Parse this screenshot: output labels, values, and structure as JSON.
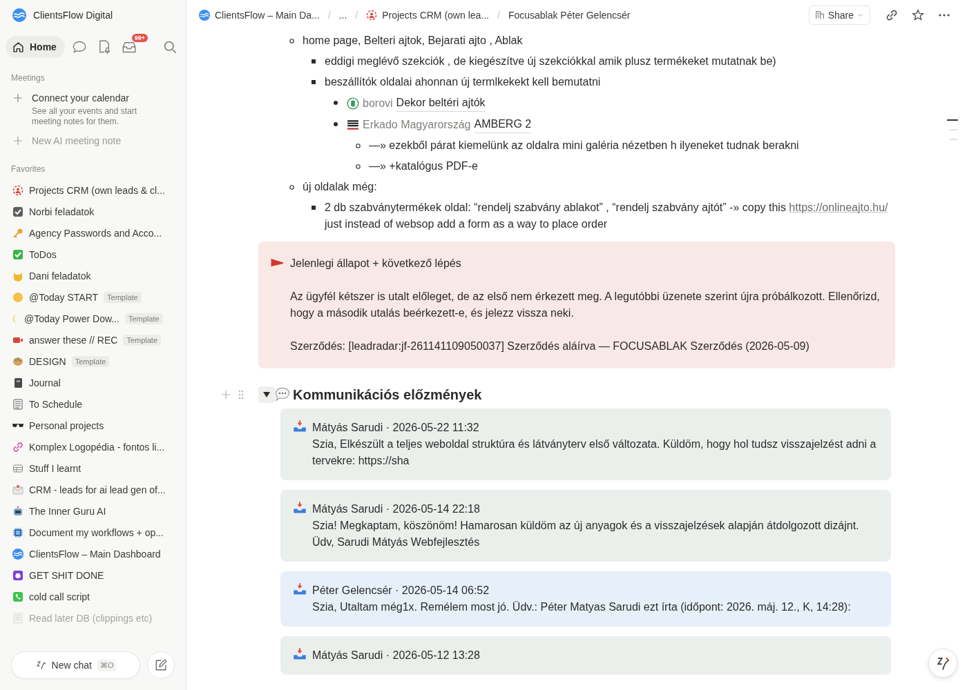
{
  "workspace": {
    "name": "ClientsFlow Digital"
  },
  "nav": {
    "home": "Home",
    "inbox_badge": "99+"
  },
  "meetings": {
    "heading": "Meetings",
    "connect_title": "Connect your calendar",
    "connect_text": "See all your events and start meeting notes for them.",
    "new_note": "New AI meeting note"
  },
  "favorites": {
    "heading": "Favorites",
    "items": [
      {
        "label": "Projects CRM (own leads & cl...",
        "faded": false
      },
      {
        "label": "Norbi feladatok",
        "faded": false
      },
      {
        "label": "Agency Passwords and Acco...",
        "faded": false
      },
      {
        "label": "ToDos",
        "faded": false
      },
      {
        "label": "Dani feladatok",
        "faded": false
      },
      {
        "label": "@Today START",
        "badge": "Template",
        "faded": false
      },
      {
        "label": "@Today Power Dow...",
        "badge": "Template",
        "faded": false
      },
      {
        "label": "answer these // REC",
        "badge": "Template",
        "faded": false
      },
      {
        "label": "DESIGN",
        "badge": "Template",
        "faded": false
      },
      {
        "label": "Journal",
        "faded": false
      },
      {
        "label": "To Schedule",
        "faded": false
      },
      {
        "label": "Personal projects",
        "faded": false
      },
      {
        "label": "Komplex Logopédia - fontos li...",
        "faded": false
      },
      {
        "label": "Stuff I learnt",
        "faded": false
      },
      {
        "label": "CRM - leads for ai lead gen of...",
        "faded": false
      },
      {
        "label": "The Inner Guru AI",
        "faded": false
      },
      {
        "label": "Document my workflows + op...",
        "faded": false
      },
      {
        "label": "ClientsFlow – Main Dashboard",
        "faded": false
      },
      {
        "label": "GET SHIT DONE",
        "faded": false
      },
      {
        "label": "cold call script",
        "faded": false
      },
      {
        "label": "Read later DB (clippings etc)",
        "faded": true
      }
    ]
  },
  "new_chat": {
    "label": "New chat",
    "shortcut": "⌘O"
  },
  "breadcrumbs": [
    "ClientsFlow – Main Da...",
    "...",
    "Projects CRM (own lea...",
    "Focusablak Péter Gelencsér"
  ],
  "breadcrumb_separator": "/",
  "share": "Share",
  "outline": [
    {
      "selected": true
    },
    {
      "selected": false
    },
    {
      "selected": false
    }
  ],
  "list": [
    {
      "kind": "text",
      "text": "home page, Belteri ajtok, Bejarati ajto , Ablak",
      "children": [
        {
          "kind": "text",
          "text": "eddigi meglévő szekciók , de kiegészítve új szekciókkal amik plusz termékeket mutatnak be)"
        },
        {
          "kind": "text",
          "text": "beszállítók oldalai ahonnan új termlkekekt kell bemutatni",
          "children": [
            {
              "kind": "mention",
              "prefix": "borovi",
              "title": "Dekor beltéri ajtók"
            },
            {
              "kind": "mention",
              "prefix": "Erkado Magyarország",
              "title": "AMBERG 2",
              "children": [
                {
                  "kind": "text",
                  "text": "—» ezekből párat kiemelünk az oldalra mini galéria nézetben h ilyeneket tudnak berakni"
                },
                {
                  "kind": "text",
                  "text": "—» +katalógus PDF-e"
                }
              ]
            }
          ]
        }
      ]
    },
    {
      "kind": "text",
      "text": "új oldalak még:",
      "children": [
        {
          "kind": "link_text",
          "text": "2  db szabványtermékek oldal: “rendelj szabvány ablakot” , “rendelj szabvány ajtót” -» copy this ",
          "link": "https://onlineajto.hu/",
          "after": " just instead of websop add a form as a way to place order"
        }
      ]
    }
  ],
  "callout": {
    "title": "Jelenlegi állapot + következő lépés",
    "paragraphs": [
      "Az ügyfél kétszer is utalt előleget, de az első nem érkezett meg. A legutóbbi üzenete szerint újra próbálkozott. Ellenőrizd, hogy a második utalás beérkezett-e, és jelezz vissza neki.",
      "Szerződés: [leadradar:jf-261141109050037] Szerződés aláírva — FOCUSABLAK Szerződés (2026-05-09)"
    ]
  },
  "section": {
    "title": "Kommunikációs előzmények",
    "expanded": true,
    "messages": [
      {
        "header": "Mátyás Sarudi · 2026-05-22 11:32",
        "body": "Szia, Elkészült a teljes weboldal struktúra és látványterv első változata. Küldöm, hogy hol tudsz visszajelzést adni a tervekre: https://sha",
        "color": "#ebefec"
      },
      {
        "header": "Mátyás Sarudi · 2026-05-14 22:18",
        "body": "Szia! Megkaptam, köszönöm! Hamarosan küldöm az új anyagok és a visszajelzések alapján átdolgozott dizájnt. Üdv, Sarudi Mátyás Webfejlesztés",
        "color": "#ebefec"
      },
      {
        "header": "Péter Gelencsér · 2026-05-14 06:52",
        "body": "Szia, Utaltam még1x. Remélem most jó. Üdv.: Péter Matyas Sarudi ezt írta (időpont: 2026. máj. 12., K, 14:28):",
        "color": "#e7f0f9"
      },
      {
        "header": "Mátyás Sarudi · 2026-05-12 13:28",
        "color": "#ebefec"
      }
    ]
  }
}
